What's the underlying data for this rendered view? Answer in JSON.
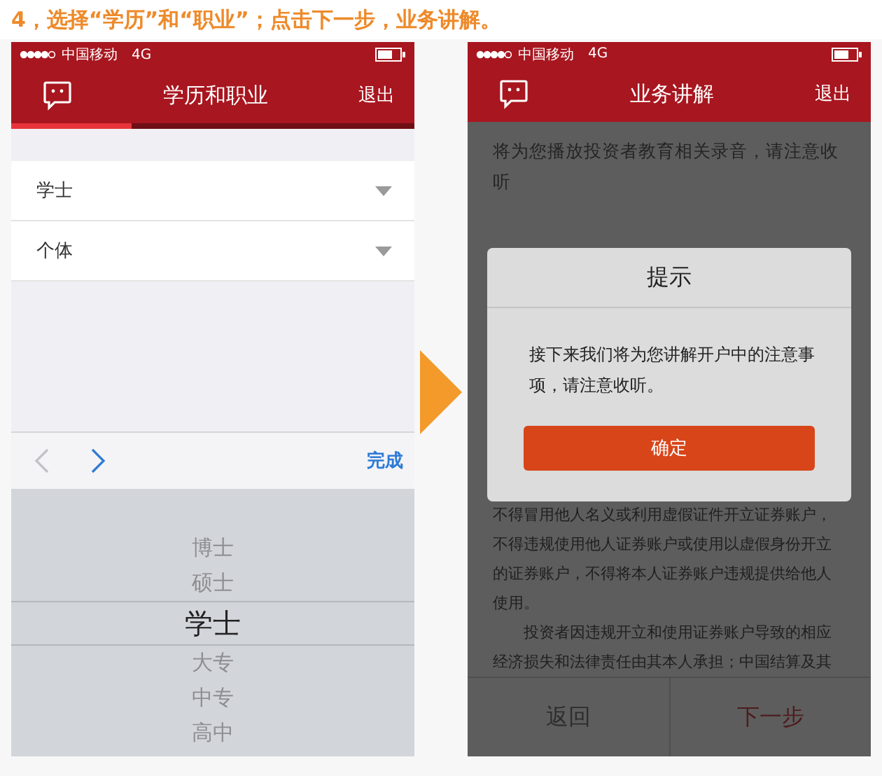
{
  "caption": "4，选择“学历”和“职业”；点击下一步，业务讲解。",
  "form_screen": {
    "status": {
      "carrier": "中国移动",
      "network": "4G"
    },
    "nav": {
      "title": "学历和职业",
      "action": "退出"
    },
    "progress": {
      "level": 0.3
    },
    "fields": [
      {
        "value": "学士"
      },
      {
        "value": "个体"
      }
    ],
    "toolbar": {
      "prev_disabled": true,
      "next_disabled": false,
      "done": "完成"
    },
    "picker": [
      {
        "label": "博士",
        "selected": false
      },
      {
        "label": "硕士",
        "selected": false
      },
      {
        "label": "学士",
        "selected": true
      },
      {
        "label": "大专",
        "selected": false
      },
      {
        "label": "中专",
        "selected": false
      },
      {
        "label": "高中",
        "selected": false
      }
    ]
  },
  "explain_screen": {
    "status": {
      "carrier": "中国移动",
      "network": "4G"
    },
    "nav": {
      "title": "业务讲解",
      "action": "退出"
    },
    "intro": "将为您播放投资者教育相关录音，请注意收听",
    "paragraphs": [
      "不得冒用他人名义或利用虚假证件开立证券账户，不得违规使用他人证券账户或使用以虚假身份开立的证券账户，不得将本人证券账户违规提供给他人使用。",
      "投资者因违规开立和使用证券账户导致的相应经济损失和法律责任由其本人承担；中国结算及其"
    ],
    "dialog": {
      "title": "提示",
      "message": "接下来我们将为您讲解开户中的注意事项，请注意收听。",
      "confirm": "确定"
    },
    "footer": {
      "back": "返回",
      "next": "下一步"
    }
  }
}
